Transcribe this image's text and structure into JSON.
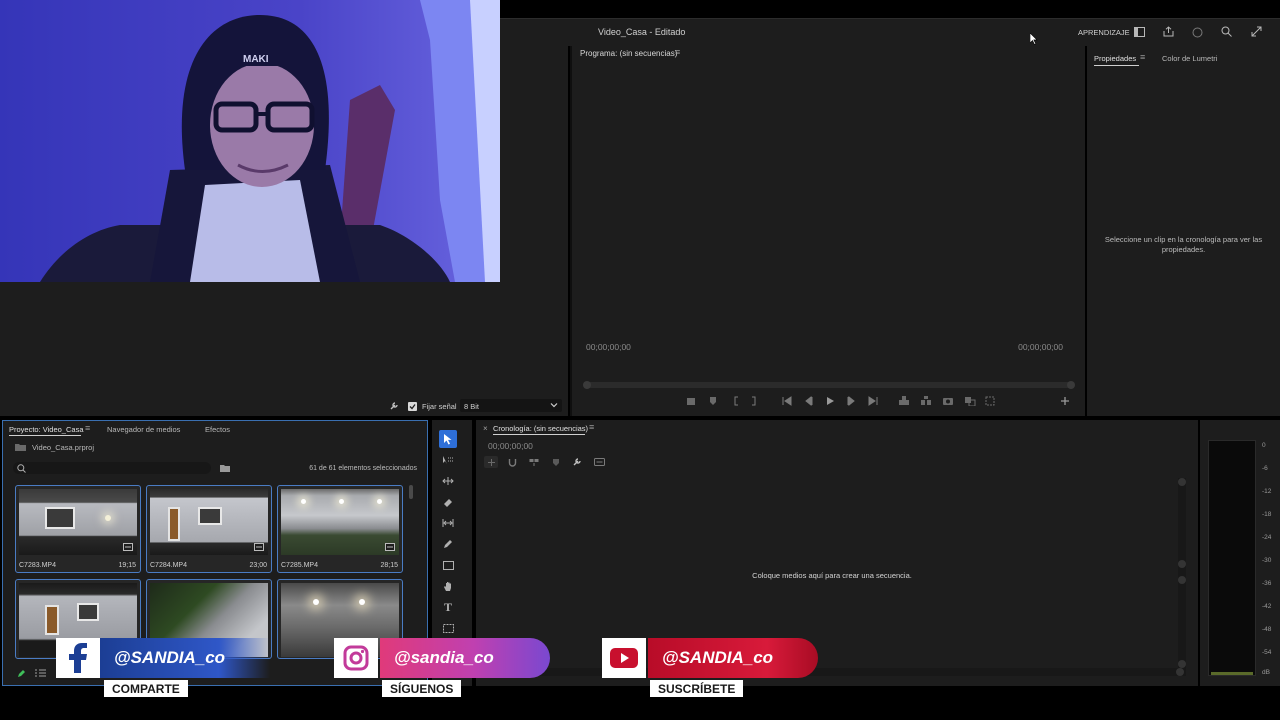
{
  "window": {
    "title": "Video_Casa - Editado",
    "learn_label": "APRENDIZAJE"
  },
  "source_panel": {
    "fix_signal_label": "Fijar señal",
    "bit_depth_value": "8 Bit"
  },
  "program_monitor": {
    "tab_label": "Programa: (sin secuencias)",
    "timecode_in": "00;00;00;00",
    "timecode_out": "00;00;00;00"
  },
  "properties_panel": {
    "tabs": [
      "Propiedades",
      "Color de Lumetri"
    ],
    "empty_message": "Seleccione un clip en la cronología para ver las propiedades."
  },
  "project_panel": {
    "tabs": [
      "Proyecto: Video_Casa",
      "Navegador de medios",
      "Efectos"
    ],
    "project_file": "Video_Casa.prproj",
    "selection_count": "61 de 61 elementos seleccionados",
    "clips": [
      {
        "name": "C7283.MP4",
        "duration": "19;15"
      },
      {
        "name": "C7284.MP4",
        "duration": "23;00"
      },
      {
        "name": "C7285.MP4",
        "duration": "28;15"
      }
    ]
  },
  "timeline_panel": {
    "tab_label": "Cronología: (sin secuencias)",
    "timecode": "00;00;00;00",
    "drop_message": "Coloque medios aquí para crear una secuencia."
  },
  "audio_meter": {
    "db_labels": [
      "0",
      "-6",
      "-12",
      "-18",
      "-24",
      "-30",
      "-36",
      "-42",
      "-48",
      "-54",
      "dB"
    ]
  },
  "social_overlay": {
    "facebook": {
      "handle": "@SANDIA_co",
      "cta": "COMPARTE",
      "color": "#1c3e94"
    },
    "instagram": {
      "handle": "@sandia_co",
      "cta": "SÍGUENOS",
      "color": "#c23a9a"
    },
    "youtube": {
      "handle": "@SANDIA_co",
      "cta": "SUSCRÍBETE",
      "color": "#c8102e"
    }
  },
  "colors": {
    "panel_bg": "#1d1d1d",
    "accent_blue": "#3a6fb0",
    "tool_selected": "#2e6fd8"
  }
}
